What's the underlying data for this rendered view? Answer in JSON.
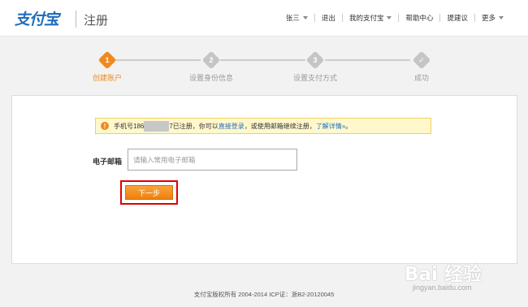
{
  "header": {
    "logo_text": "支付宝",
    "page_title": "注册",
    "nav": [
      {
        "label": "张三",
        "has_caret": true
      },
      {
        "label": "退出",
        "has_caret": false
      },
      {
        "label": "我的支付宝",
        "has_caret": true
      },
      {
        "label": "帮助中心",
        "has_caret": false
      },
      {
        "label": "提建议",
        "has_caret": false
      },
      {
        "label": "更多",
        "has_caret": true
      }
    ]
  },
  "steps": [
    {
      "num": "1",
      "label": "创建账户",
      "active": true
    },
    {
      "num": "2",
      "label": "设置身份信息",
      "active": false
    },
    {
      "num": "3",
      "label": "设置支付方式",
      "active": false
    },
    {
      "num": "✓",
      "label": "成功",
      "active": false
    }
  ],
  "notice": {
    "icon": "!",
    "prefix": "手机号186",
    "middle": "7已注册，你可以",
    "login_link": "直接登录",
    "after_login": "，或使用邮箱继续注册，",
    "details_link": "了解详情",
    "details_suffix": "»",
    "end": "。"
  },
  "form": {
    "email_label": "电子邮箱",
    "email_placeholder": "请输入常用电子邮箱",
    "email_value": "",
    "next_button": "下一步"
  },
  "footer": {
    "text": "支付宝版权所有 2004-2014 ICP证：浙B2-20120045"
  },
  "watermark": {
    "main": "Bai 经验",
    "sub": "jingyan.baidu.com"
  },
  "colors": {
    "accent": "#f08a1e",
    "link": "#1f6ebf",
    "highlight": "#e00000",
    "notice_bg": "#fff8cc"
  }
}
